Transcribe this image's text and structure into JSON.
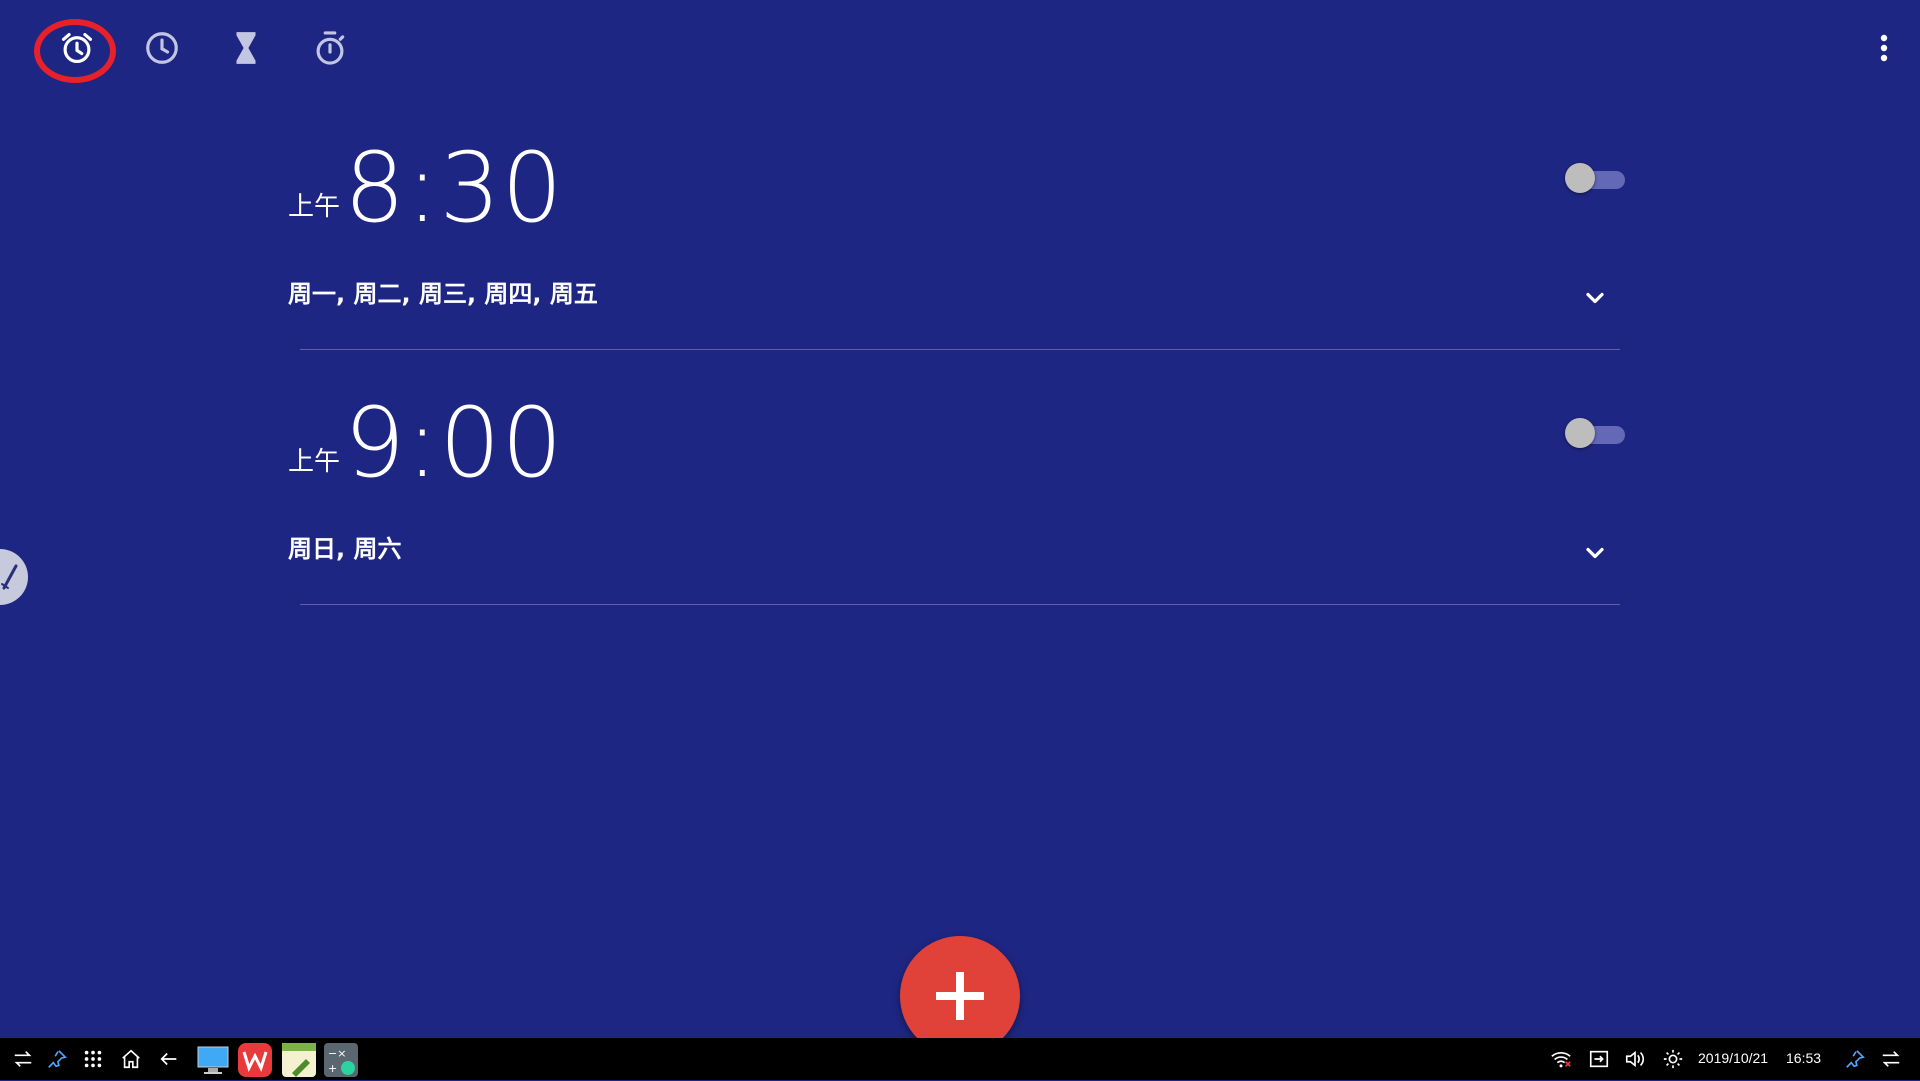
{
  "tabs": [
    {
      "name": "alarm",
      "icon": "alarm-clock-icon",
      "selected": true
    },
    {
      "name": "clock",
      "icon": "clock-icon"
    },
    {
      "name": "timer",
      "icon": "hourglass-icon"
    },
    {
      "name": "stopwatch",
      "icon": "stopwatch-icon"
    }
  ],
  "alarms": [
    {
      "ampm": "上午",
      "time": "8:30",
      "days": "周一, 周二, 周三, 周四, 周五",
      "enabled": false
    },
    {
      "ampm": "上午",
      "time": "9:00",
      "days": "周日, 周六",
      "enabled": false
    }
  ],
  "fab": {
    "icon": "plus-icon"
  },
  "taskbar": {
    "date": "2019/10/21",
    "time": "16:53"
  },
  "colors": {
    "background": "#1E2683",
    "fab": "#E0423A",
    "highlight": "#E8202A",
    "toggle_track": "#6369B7",
    "toggle_thumb": "#BDBDBD",
    "taskbar": "#000000"
  }
}
